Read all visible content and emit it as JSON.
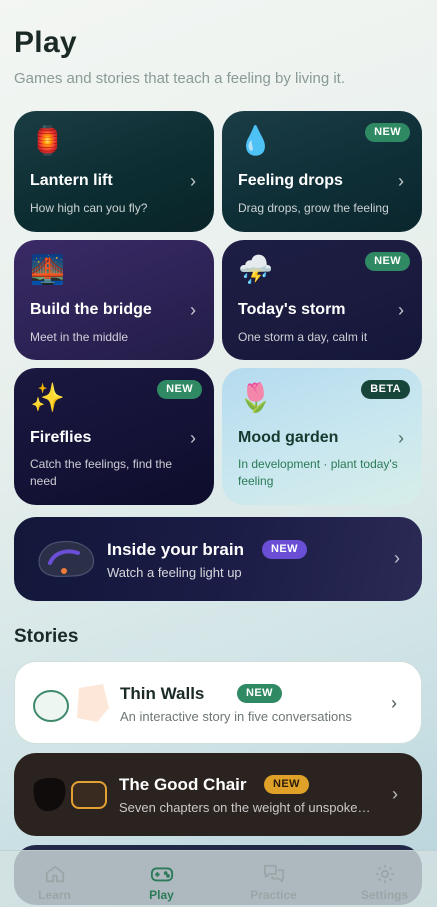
{
  "header": {
    "title": "Play",
    "subtitle": "Games and stories that teach a feeling by living it."
  },
  "games": [
    {
      "title": "Lantern lift",
      "subtitle": "How high can you fly?",
      "icon": "🏮",
      "icon_name": "lantern-icon",
      "badge": ""
    },
    {
      "title": "Feeling drops",
      "subtitle": "Drag drops, grow the feeling",
      "icon": "💧",
      "icon_name": "droplet-icon",
      "badge": "NEW"
    },
    {
      "title": "Build the bridge",
      "subtitle": "Meet in the middle",
      "icon": "🌉",
      "icon_name": "bridge-icon",
      "badge": ""
    },
    {
      "title": "Today's storm",
      "subtitle": "One storm a day, calm it",
      "icon": "⛈️",
      "icon_name": "storm-cloud-icon",
      "badge": "NEW"
    },
    {
      "title": "Fireflies",
      "subtitle": "Catch the feelings, find the need",
      "icon": "✨",
      "icon_name": "sparkles-icon",
      "badge": "NEW"
    },
    {
      "title": "Mood garden",
      "subtitle": "In development · plant today's feeling",
      "icon": "🌷",
      "icon_name": "tulip-icon",
      "badge": "BETA"
    }
  ],
  "brain": {
    "title": "Inside your brain",
    "subtitle": "Watch a feeling light up",
    "badge": "NEW"
  },
  "stories_section": {
    "title": "Stories",
    "items": [
      {
        "title": "Thin Walls",
        "subtitle": "An interactive story in five conversations",
        "badge": "NEW"
      },
      {
        "title": "The Good Chair",
        "subtitle": "Seven chapters on the weight of unspoken things",
        "badge": "NEW"
      }
    ]
  },
  "tabbar": {
    "tabs": [
      {
        "label": "Learn",
        "icon": "house-icon",
        "active": false
      },
      {
        "label": "Play",
        "icon": "gamepad-icon",
        "active": true
      },
      {
        "label": "Practice",
        "icon": "chat-bubbles-icon",
        "active": false
      },
      {
        "label": "Settings",
        "icon": "gear-icon",
        "active": false
      }
    ]
  },
  "colors": {
    "accent_green": "#2f8a63",
    "beta_badge": "#18453a",
    "brain_badge": "#6a4ed6",
    "chair_badge": "#e0a128"
  }
}
